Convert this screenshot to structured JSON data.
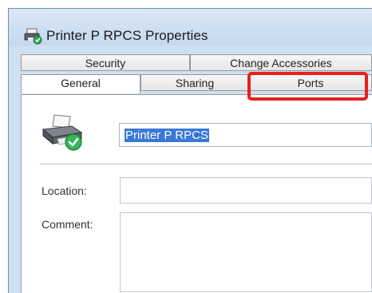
{
  "window": {
    "title": "Printer P RPCS Properties"
  },
  "tabs": {
    "row_back": [
      "Security",
      "Change Accessories"
    ],
    "row_front": [
      "General",
      "Sharing",
      "Ports"
    ],
    "active": "General"
  },
  "general": {
    "printer_name": "Printer P RPCS",
    "location_label": "Location:",
    "location_value": "",
    "comment_label": "Comment:",
    "comment_value": ""
  },
  "icons": {
    "title": "printer-check-icon",
    "printer": "printer-check-icon"
  },
  "colors": {
    "highlight": "#e6201e",
    "selection": "#3a78d8"
  }
}
